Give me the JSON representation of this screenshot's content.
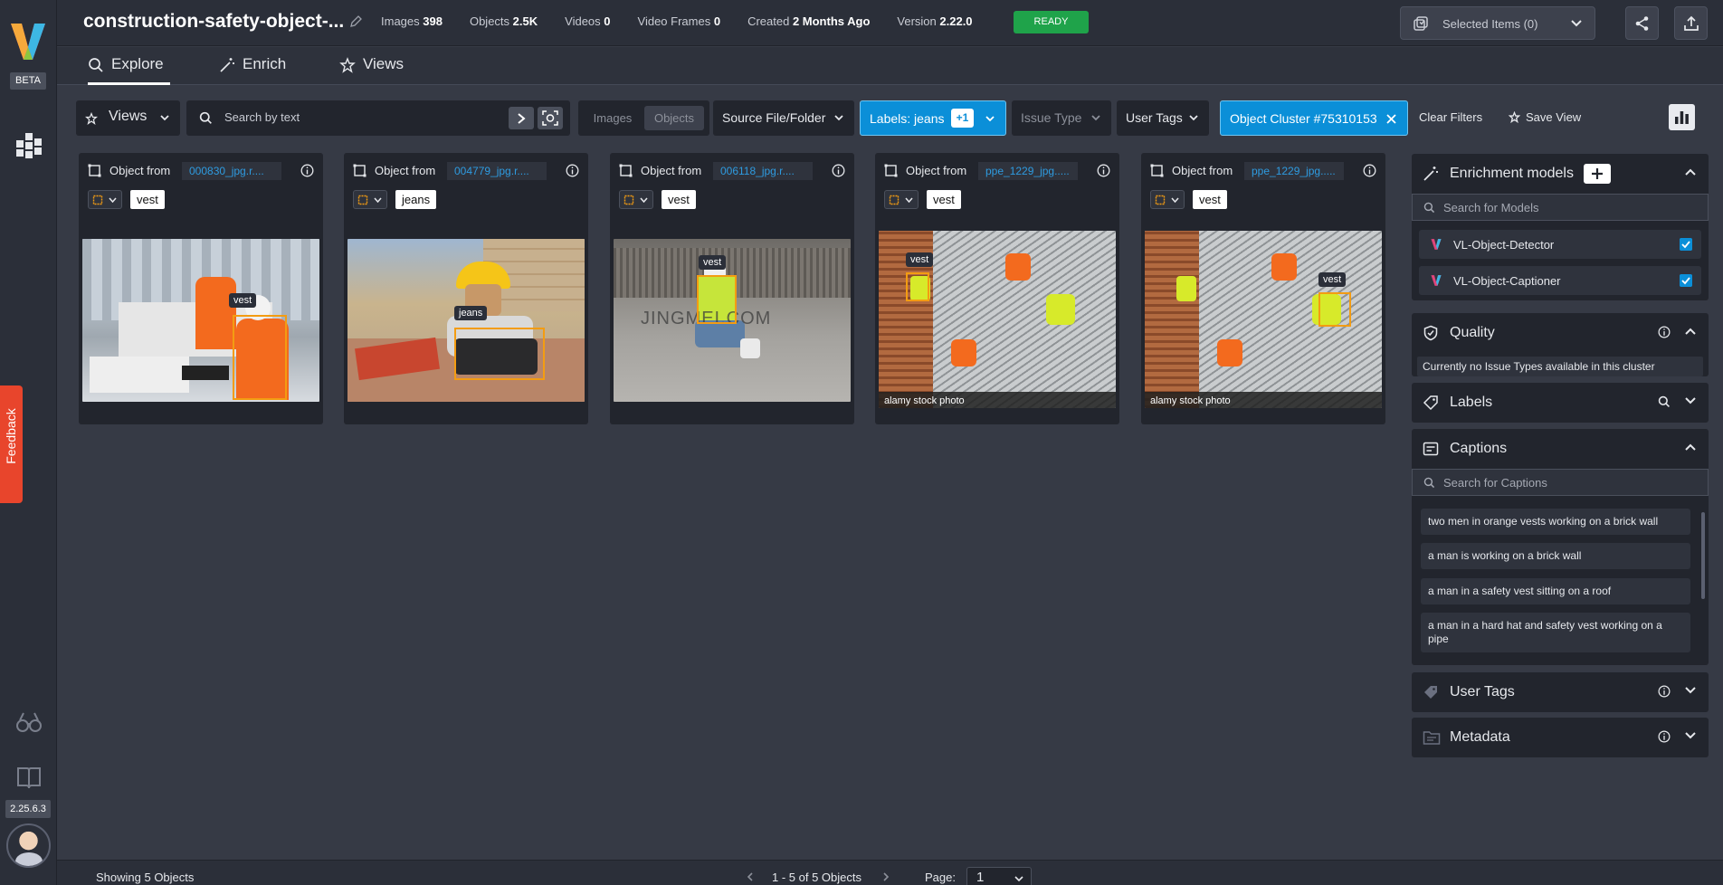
{
  "app": {
    "beta_label": "BETA",
    "version": "2.25.6.3",
    "feedback": "Feedback"
  },
  "dataset": {
    "name": "construction-safety-object-...",
    "stats": [
      {
        "label": "Images",
        "value": "398"
      },
      {
        "label": "Objects",
        "value": "2.5K"
      },
      {
        "label": "Videos",
        "value": "0"
      },
      {
        "label": "Video Frames",
        "value": "0"
      },
      {
        "label": "Created",
        "value": "2 Months Ago"
      },
      {
        "label": "Version",
        "value": "2.22.0"
      }
    ],
    "status": "READY"
  },
  "header": {
    "selected_items": "Selected Items (0)"
  },
  "tabs": [
    {
      "label": "Explore"
    },
    {
      "label": "Enrich"
    },
    {
      "label": "Views"
    }
  ],
  "filters": {
    "views": "Views",
    "search_placeholder": "Search by text",
    "segment": [
      "Images",
      "Objects"
    ],
    "source": "Source File/Folder",
    "labels": "Labels: jeans",
    "labels_extra": "+1",
    "issue_type": "Issue Type",
    "user_tags": "User Tags",
    "cluster": "Object Cluster #75310153",
    "clear": "Clear Filters",
    "save_view": "Save View"
  },
  "cards": [
    {
      "from": "Object from",
      "file": "000830_jpg.r....",
      "tag": "vest",
      "det_label": "vest"
    },
    {
      "from": "Object from",
      "file": "004779_jpg.r....",
      "tag": "jeans",
      "det_label": "jeans"
    },
    {
      "from": "Object from",
      "file": "006118_jpg.r....",
      "tag": "vest",
      "det_label": "vest",
      "watermark": "JINGMEI.COM"
    },
    {
      "from": "Object from",
      "file": "ppe_1229_jpg.....",
      "tag": "vest",
      "det_label": "vest",
      "watermark": "alamy stock photo"
    },
    {
      "from": "Object from",
      "file": "ppe_1229_jpg.....",
      "tag": "vest",
      "det_label": "vest",
      "watermark": "alamy stock photo"
    }
  ],
  "panel": {
    "enrichment": {
      "title": "Enrichment models",
      "search_placeholder": "Search for Models",
      "models": [
        {
          "name": "VL-Object-Detector"
        },
        {
          "name": "VL-Object-Captioner"
        }
      ]
    },
    "quality": {
      "title": "Quality",
      "note": "Currently no Issue Types available in this cluster"
    },
    "labels": {
      "title": "Labels"
    },
    "captions": {
      "title": "Captions",
      "search_placeholder": "Search for Captions",
      "items": [
        "two men in orange vests working on a brick wall",
        "a man is working on a brick wall",
        "a man in a safety vest sitting on a roof",
        "a man in a hard hat and safety vest working on a pipe"
      ]
    },
    "user_tags": {
      "title": "User Tags"
    },
    "metadata": {
      "title": "Metadata"
    }
  },
  "footer": {
    "showing": "Showing 5 Objects",
    "range": "1 - 5 of 5 Objects",
    "page_label": "Page:",
    "page": "1"
  }
}
